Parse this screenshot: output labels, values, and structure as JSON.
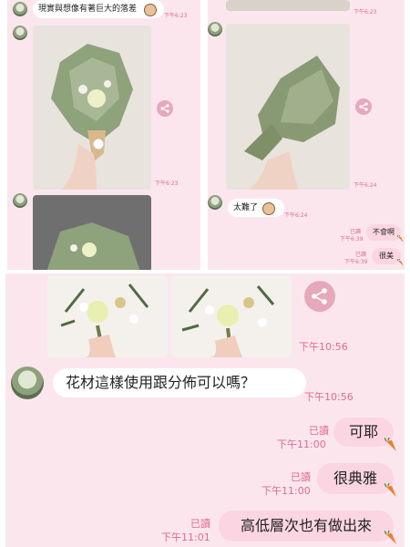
{
  "top_left": {
    "top_message": "現實與想像有著巨大的落差",
    "top_time": "下午6:23",
    "photo1_time": "下午6:23"
  },
  "top_right": {
    "time_a": "下午6:23",
    "photo_time": "下午6:24",
    "msg_difficult": "太難了",
    "msg_difficult_time": "下午6:24",
    "read1": "已讀",
    "read1_time": "下午6:39",
    "msg_no": "不會啊",
    "read2": "已讀",
    "read2_time": "下午6:39",
    "msg_beautiful": "很美"
  },
  "bottom": {
    "photo_time": "下午10:56",
    "question": "花材這樣使用跟分佈可以嗎？",
    "question_time": "下午10:56",
    "replies": [
      {
        "read": "已讀",
        "time": "下午11:00",
        "text": "可耶"
      },
      {
        "read": "已讀",
        "time": "下午11:00",
        "text": "很典雅"
      },
      {
        "read": "已讀",
        "time": "下午11:01",
        "text": "高低層次也有做出來"
      }
    ]
  },
  "colors": {
    "panel_bg": "#fbe6ee",
    "my_bubble": "#fbd6e2",
    "timestamp": "#e26a8f",
    "share_button": "#e6a9bb"
  }
}
